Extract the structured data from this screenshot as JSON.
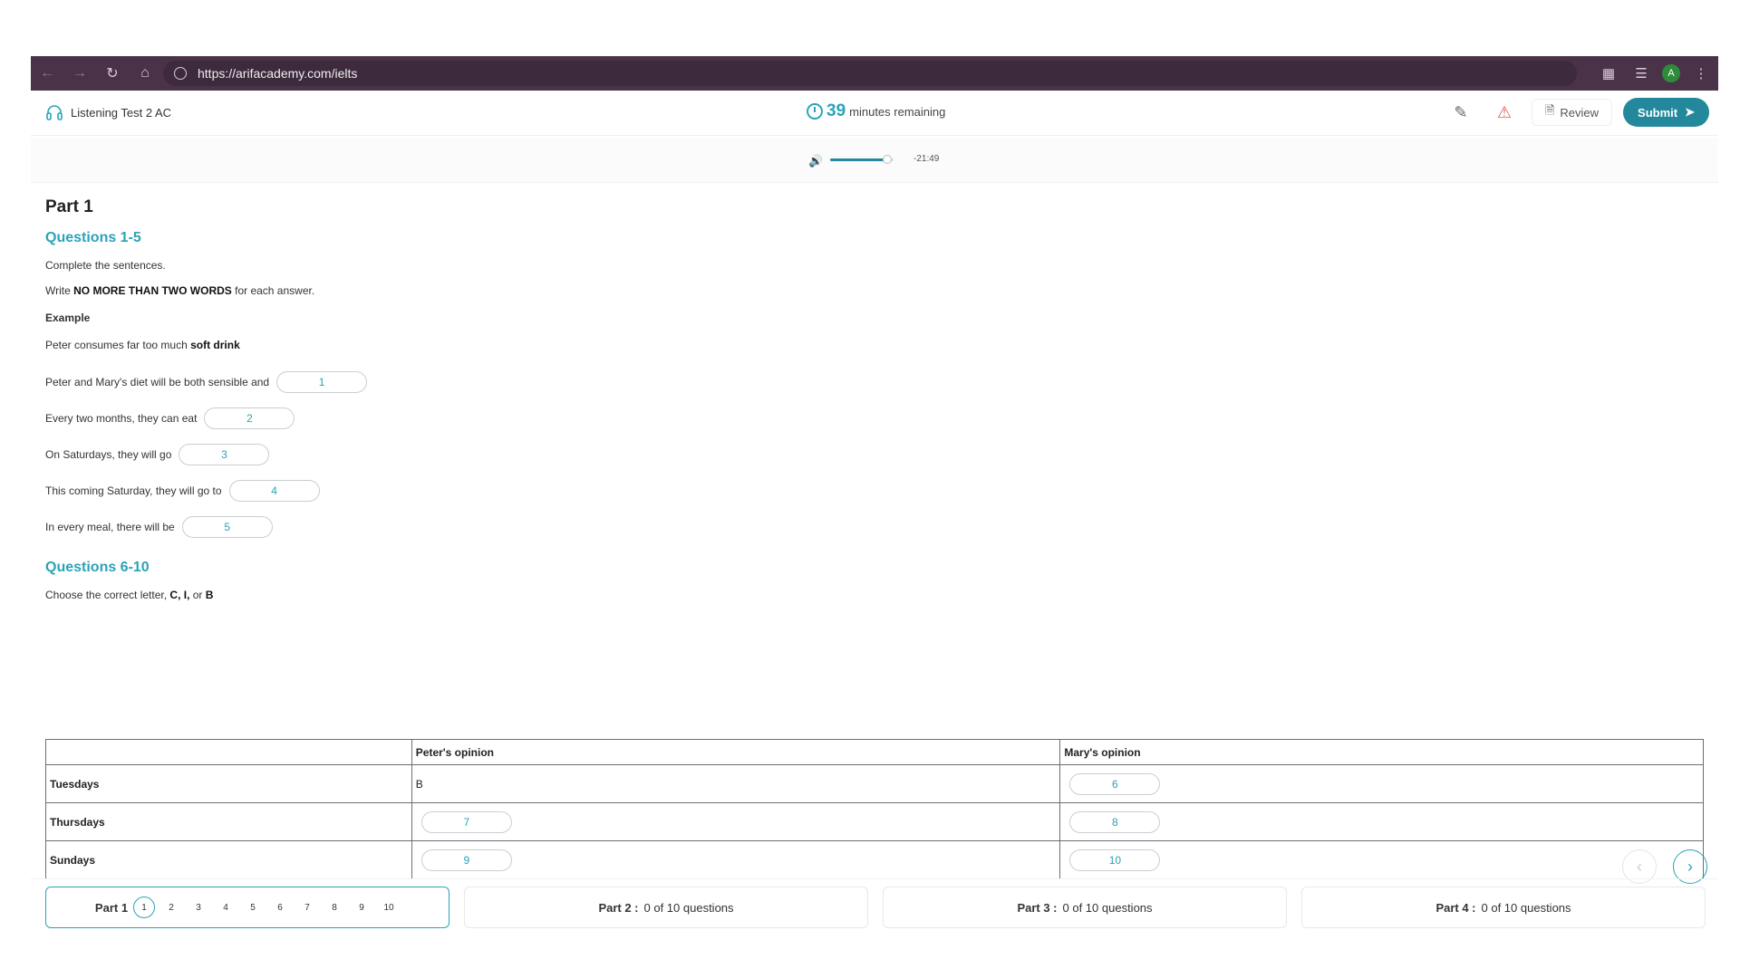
{
  "browser": {
    "url": "https://arifacademy.com/ielts",
    "avatar_letter": "A"
  },
  "header": {
    "test_title": "Listening Test 2 AC",
    "timer_minutes": "39",
    "timer_text": "minutes remaining",
    "review_label": "Review",
    "submit_label": "Submit"
  },
  "audio": {
    "time": "-21:49",
    "volume_level": 0.9
  },
  "part1": {
    "title": "Part 1",
    "q1_heading": "Questions 1-5",
    "instruction1": "Complete the sentences.",
    "instruction2_pre": "Write ",
    "instruction2_bold": "NO MORE THAN TWO WORDS",
    "instruction2_post": " for each answer.",
    "example_label": "Example",
    "example_pre": "Peter consumes far too much ",
    "example_bold": "soft drink",
    "sentences": [
      {
        "text": "Peter and Mary's diet will be both sensible and",
        "num": "1"
      },
      {
        "text": "Every two months, they can eat",
        "num": "2"
      },
      {
        "text": "On Saturdays, they will go",
        "num": "3"
      },
      {
        "text": "This coming Saturday, they will go to",
        "num": "4"
      },
      {
        "text": "In every meal, there will be",
        "num": "5"
      }
    ],
    "q6_heading": "Questions 6-10",
    "choose_pre": "Choose the correct letter, ",
    "choose_bold": "C, I,",
    "choose_mid": " or ",
    "choose_bold2": "B",
    "table": {
      "headers": [
        "",
        "Peter's opinion",
        "Mary's opinion"
      ],
      "rows": [
        {
          "day": "Tuesdays",
          "peter": "B",
          "mary": "6"
        },
        {
          "day": "Thursdays",
          "peter": "7",
          "mary": "8"
        },
        {
          "day": "Sundays",
          "peter": "9",
          "mary": "10"
        }
      ]
    }
  },
  "footer": {
    "part1_label": "Part 1",
    "part1_questions": [
      "1",
      "2",
      "3",
      "4",
      "5",
      "6",
      "7",
      "8",
      "9",
      "10"
    ],
    "part2_label": "Part 2 :",
    "part2_status": "0 of 10 questions",
    "part3_label": "Part 3 :",
    "part3_status": "0 of 10 questions",
    "part4_label": "Part 4 :",
    "part4_status": "0 of 10 questions"
  },
  "colors": {
    "accent": "#2aa3b8",
    "submit": "#23889b",
    "browser_bar": "#4a3249"
  },
  "icons": [
    "back-icon",
    "forward-icon",
    "reload-icon",
    "home-icon",
    "site-info-icon",
    "extensions-icon",
    "media-icon",
    "menu-icon",
    "headphones-icon",
    "clock-icon",
    "notes-icon",
    "warning-icon",
    "review-icon",
    "send-icon",
    "volume-icon",
    "chevron-left-icon",
    "chevron-right-icon"
  ]
}
